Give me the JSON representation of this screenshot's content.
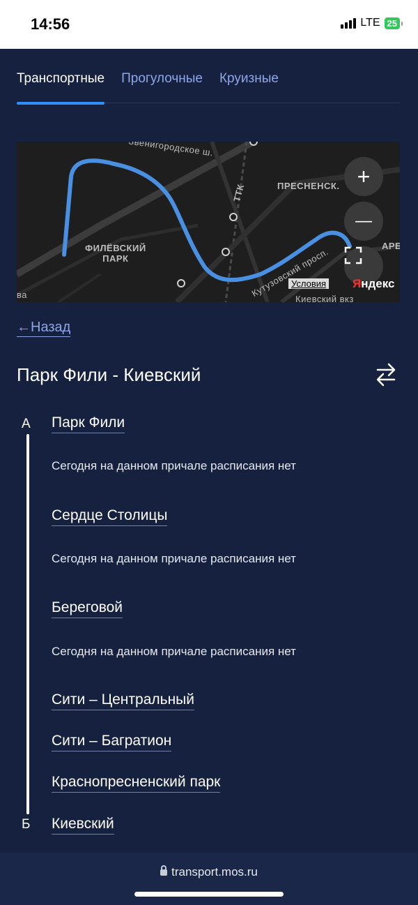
{
  "status_bar": {
    "time": "14:56",
    "network": "LTE",
    "battery": "25"
  },
  "tabs": [
    {
      "label": "Транспортные",
      "active": true
    },
    {
      "label": "Прогулочные",
      "active": false
    },
    {
      "label": "Круизные",
      "active": false
    }
  ],
  "map": {
    "labels": {
      "street1": "Звенигородское ш.",
      "ttk": "ТТК",
      "district": "ПРЕСНЕНСК.",
      "park": "ФИЛЁВСКИЙ\nПАРК",
      "street2": "Кутузовский просп.",
      "kiev": "Киевский вкз",
      "edge_left": "ва",
      "edge_right": "АРБ"
    },
    "zoom_in": "+",
    "zoom_out": "—",
    "terms": "Условия",
    "logo_red": "Я",
    "logo_rest": "ндекс",
    "route_color": "#4a90e2"
  },
  "back_link": "←Назад",
  "route_title": "Парк Фили - Киевский",
  "markers": {
    "start": "А",
    "end": "Б"
  },
  "stops": [
    {
      "name": "Парк Фили",
      "note": "Сегодня на данном причале расписания нет"
    },
    {
      "name": "Сердце Столицы",
      "note": "Сегодня на данном причале расписания нет"
    },
    {
      "name": "Береговой",
      "note": "Сегодня на данном причале расписания нет"
    },
    {
      "name": "Сити – Центральный",
      "note": ""
    },
    {
      "name": "Сити – Багратион",
      "note": ""
    },
    {
      "name": "Краснопресненский парк",
      "note": ""
    },
    {
      "name": "Киевский",
      "note": ""
    }
  ],
  "browser": {
    "url": "transport.mos.ru"
  }
}
